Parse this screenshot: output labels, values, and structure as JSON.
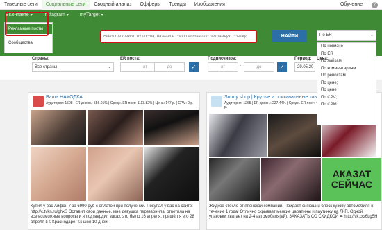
{
  "topnav": {
    "tabs": [
      "Тизерные сети",
      "Социальные сети",
      "Сводный анализ",
      "Офферы",
      "Тренды",
      "Изображения"
    ],
    "right": "Обучение",
    "help": "?"
  },
  "subnav": {
    "items": [
      {
        "label": "ВКонтакте",
        "caret": "▾"
      },
      {
        "label": "Instagram",
        "caret": "▾"
      },
      {
        "label": "myTarget",
        "caret": "▾"
      }
    ]
  },
  "vk_dropdown": {
    "options": [
      "Рекламные посты",
      "Сообщества"
    ]
  },
  "search": {
    "placeholder": "Введите текст из поста, название сообщества или рекламную ссылку",
    "button": "НАЙТИ"
  },
  "sort": {
    "selected": "По ER",
    "options": [
      "По новизне",
      "По ER",
      "По лайкам",
      "По комментариям",
      "По репостам",
      "По цене;",
      "По цене↑",
      "По CPV;",
      "По CPM↑"
    ]
  },
  "filters": {
    "country_label": "Страны:",
    "country_value": "Все страны",
    "er_label": "ER поста:",
    "er_from": "от",
    "er_to": "до",
    "subs_label": "Подписчиков:",
    "subs_from": "от",
    "subs_to": "до",
    "price_label": "Цена:",
    "period_label": "Период:",
    "period_value": "29.05.20",
    "confirm": "✓"
  },
  "colors": {
    "green": "#3f8a34",
    "blue": "#2c6fa6",
    "highlight_red": "#d4101b"
  },
  "cards": [
    {
      "name": "Ваша НАХОДКА",
      "stats": "Аудитория: 1508 | ER дневн.: 556.01% | Средн. ER пост: 1113.82% | Цена: 147 р. | CPM: 0 р.",
      "text": "Купил у вас Айфон 7 за 6990 руб с оплатой при получении. Покупал у вас на сайте: http://c.tvkn.ru/ghxS Оставил свои данные, мне девушка перезвонила, ответила на все возможные вопросы и я подтвердил заказ, это было 16 апреля, пришёл я его 28 апреля в г. Краснодаре, т.к шел 10 дней."
    },
    {
      "name": "Sunny shop | Крутые и оригинальные товары",
      "stats": "Аудитория: 1265 | ER дневн.: 227.44% | Средн. ER пост: 454.87% | Цена: 147 р. | CPM: 2387 р.",
      "text": "Жидкое стекло от японской компании. Придает сияющий блеск кузову автомобиля в течение 1 года! Отлично скрывает мелкие царапины и паутинку на ЛКП. Одной упаковки хватает на 2-4 автомобиля(ей). ЗАКАЗАТЬ СО СКИДКОЙ ➡ http://vk.cc/6Lg5H",
      "ad_text": "АКАЗАТ СЕЙЧАС"
    }
  ]
}
